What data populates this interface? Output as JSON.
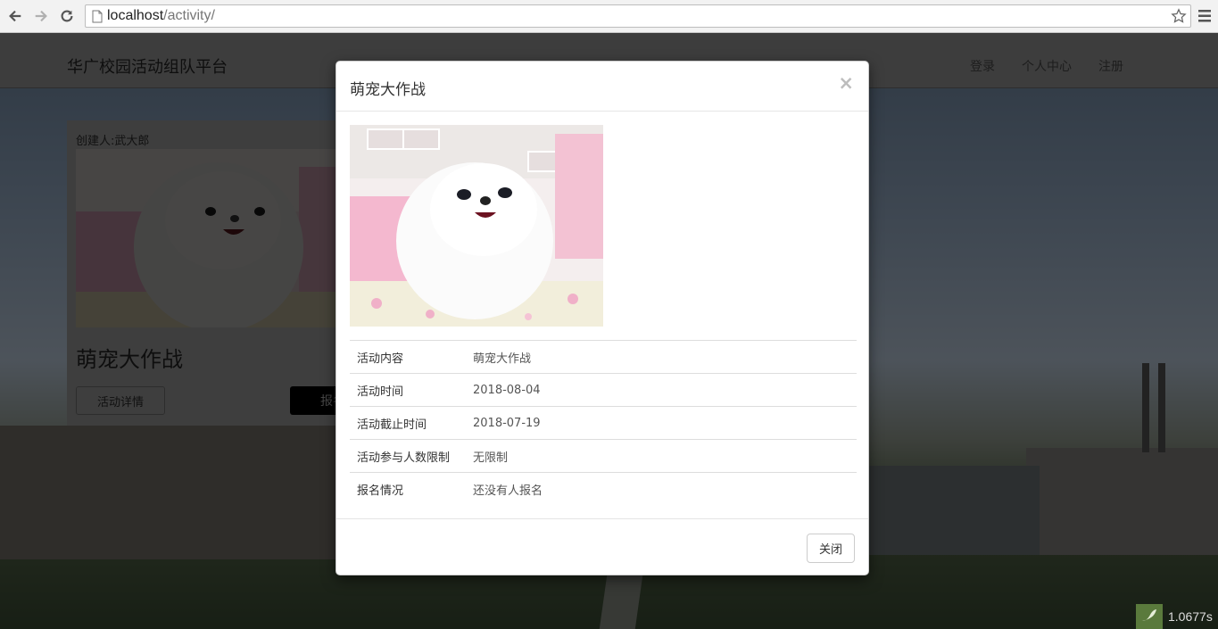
{
  "browser": {
    "url_host": "localhost",
    "url_path": "/activity/"
  },
  "navbar": {
    "brand": "华广校园活动组队平台",
    "links": [
      "登录",
      "个人中心",
      "注册"
    ]
  },
  "card": {
    "creator": "创建人:武大郎",
    "title": "萌宠大作战",
    "detail_button": "活动详情",
    "signup_button": "报名"
  },
  "modal": {
    "title": "萌宠大作战",
    "close_x": "×",
    "rows": [
      {
        "label": "活动内容",
        "value": "萌宠大作战"
      },
      {
        "label": "活动时间",
        "value": "2018-08-04"
      },
      {
        "label": "活动截止时间",
        "value": "2018-07-19"
      },
      {
        "label": "活动参与人数限制",
        "value": "无限制"
      },
      {
        "label": "报名情况",
        "value": "还没有人报名"
      }
    ],
    "close_button": "关闭"
  },
  "perf": {
    "time": "1.0677s"
  }
}
